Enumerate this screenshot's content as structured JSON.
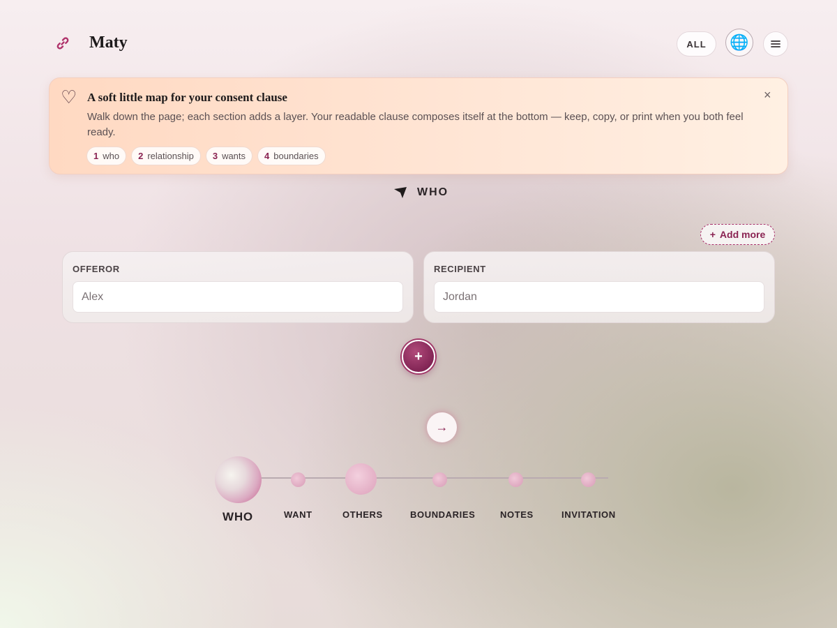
{
  "app": {
    "title": "Maty",
    "logo_icon": "link-icon"
  },
  "header": {
    "filter_label": "ALL",
    "globe_icon": "globe-icon",
    "menu_icon": "menu-icon"
  },
  "notice": {
    "title": "A soft little map for your consent clause",
    "body": "Walk down the page; each section adds a layer. Your readable clause composes itself at the bottom — keep, copy, or print when you both feel ready.",
    "close_label": "×",
    "steps": [
      {
        "num": "1",
        "label": "who"
      },
      {
        "num": "2",
        "label": "relationship"
      },
      {
        "num": "3",
        "label": "wants"
      },
      {
        "num": "4",
        "label": "boundaries"
      }
    ]
  },
  "section": {
    "label": "WHO",
    "add_more_label": "Add more",
    "add_more_icon": "+"
  },
  "parties": {
    "offeror": {
      "label": "OFFEROR",
      "value": "Alex"
    },
    "recipient": {
      "label": "RECIPIENT",
      "value": "Jordan"
    }
  },
  "actions": {
    "add_label": "+",
    "next_label": "→"
  },
  "timeline": {
    "active": "WHO",
    "steps": [
      "WHO",
      "WANT",
      "OTHERS",
      "BOUNDARIES",
      "NOTES",
      "INVITATION"
    ]
  },
  "colors": {
    "accent": "#8a2352",
    "notice_bg": "#ffe4d3"
  }
}
